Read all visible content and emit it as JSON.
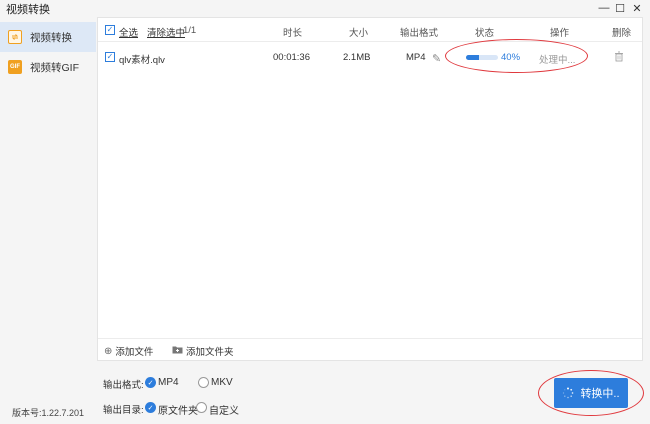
{
  "window": {
    "title": "视频转换",
    "minimize_glyph": "—",
    "maximize_glyph": "☐",
    "close_glyph": "✕"
  },
  "sidebar": {
    "items": [
      {
        "label": "视频转换",
        "icon": "video-convert-icon",
        "active": true
      },
      {
        "label": "视频转GIF",
        "icon": "gif-icon",
        "icon_text": "GIF",
        "active": false
      }
    ],
    "version": "版本号:1.22.7.201"
  },
  "table": {
    "header": {
      "select_all": "全选",
      "clear_selected": "清除选中",
      "count": "1/1",
      "duration": "时长",
      "size": "大小",
      "format": "输出格式",
      "status": "状态",
      "action": "操作",
      "delete": "删除"
    },
    "rows": [
      {
        "name": "qlv素材.qlv",
        "duration": "00:01:36",
        "size": "2.1MB",
        "format": "MP4",
        "progress_percent": 40,
        "progress_label": "40%",
        "action": "处理中..."
      }
    ]
  },
  "footer": {
    "add_file": "添加文件",
    "add_folder": "添加文件夹"
  },
  "options": {
    "output_format_label": "输出格式:",
    "format_options": [
      "MP4",
      "MKV"
    ],
    "format_selected": "MP4",
    "output_dir_label": "输出目录:",
    "dir_options": [
      "原文件夹",
      "自定义"
    ],
    "dir_selected": "原文件夹"
  },
  "convert_button": {
    "label": "转换中.."
  },
  "colors": {
    "accent": "#2d7ddc",
    "annotation": "#e0393e",
    "sidebar_active": "#dde8f6"
  }
}
